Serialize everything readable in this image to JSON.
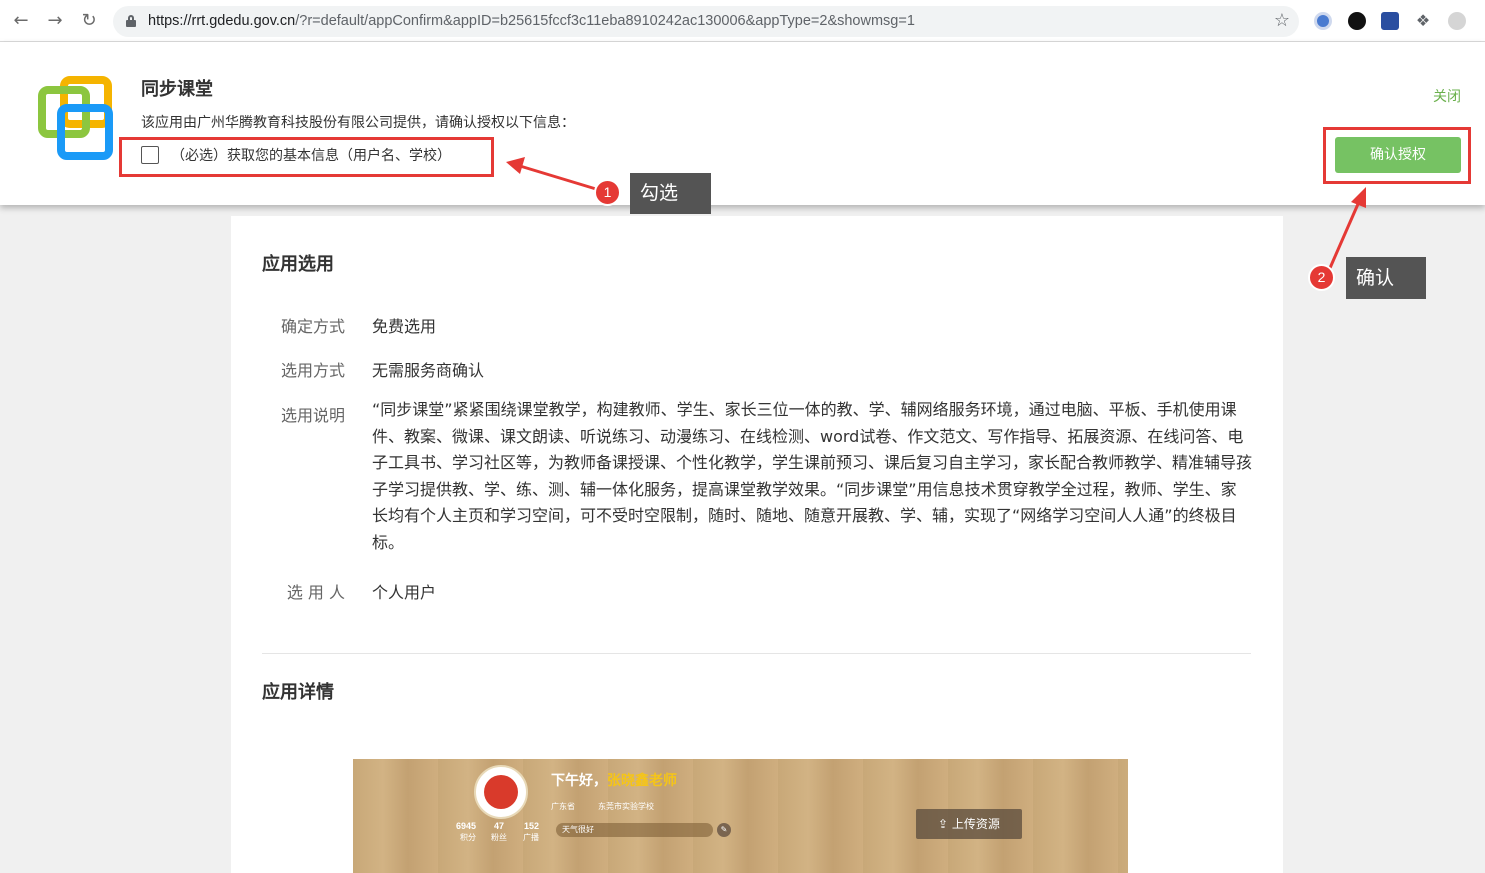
{
  "browser": {
    "back_icon": "arrow-left-icon",
    "forward_icon": "arrow-right-icon",
    "reload_icon": "reload-icon",
    "url_host": "https://rrt.gdedu.gov.cn",
    "url_rest": "/?r=default/appConfirm&appID=b25615fccf3c11eba8910242ac130006&appType=2&showmsg=1",
    "bookmark_icon": "star-icon",
    "extensions": [
      "extension-1-icon",
      "extension-2-icon",
      "extension-3-icon",
      "puzzle-icon",
      "profile-icon"
    ]
  },
  "auth": {
    "app_title": "同步课堂",
    "description": "该应用由广州华腾教育科技股份有限公司提供，请确认授权以下信息：",
    "permission_label": "（必选）获取您的基本信息（用户名、学校）",
    "close_label": "关闭",
    "confirm_label": "确认授权",
    "logo_colors": [
      "#f5b400",
      "#8cc63f",
      "#1a9af7"
    ]
  },
  "annotations": [
    {
      "number": "1",
      "label": "勾选"
    },
    {
      "number": "2",
      "label": "确认"
    }
  ],
  "selection": {
    "title": "应用选用",
    "rows": [
      {
        "key": "确定方式",
        "value": "免费选用"
      },
      {
        "key": "选用方式",
        "value": "无需服务商确认"
      },
      {
        "key": "选用说明",
        "value": "“同步课堂”紧紧围绕课堂教学，构建教师、学生、家长三位一体的教、学、辅网络服务环境，通过电脑、平板、手机使用课件、教案、微课、课文朗读、听说练习、动漫练习、在线检测、word试卷、作文范文、写作指导、拓展资源、在线问答、电子工具书、学习社区等，为教师备课授课、个性化教学，学生课前预习、课后复习自主学习，家长配合教师教学、精准辅导孩子学习提供教、学、练、测、辅一体化服务，提高课堂教学效果。“同步课堂”用信息技术贯穿教学全过程，教师、学生、家长均有个人主页和学习空间，可不受时空限制，随时、随地、随意开展教、学、辅，实现了“网络学习空间人人通”的终极目标。"
      },
      {
        "key": "选 用 人",
        "value": "个人用户"
      }
    ]
  },
  "details": {
    "title": "应用详情",
    "preview": {
      "greeting": "下午好，",
      "teacher_name": "张晓鑫老师",
      "province": "广东省",
      "school": "东莞市实验学校",
      "stats": [
        {
          "num": "6945",
          "label": "积分"
        },
        {
          "num": "47",
          "label": "粉丝"
        },
        {
          "num": "152",
          "label": "广播"
        }
      ],
      "weather": "天气很好",
      "upload_label": "上传资源"
    }
  }
}
